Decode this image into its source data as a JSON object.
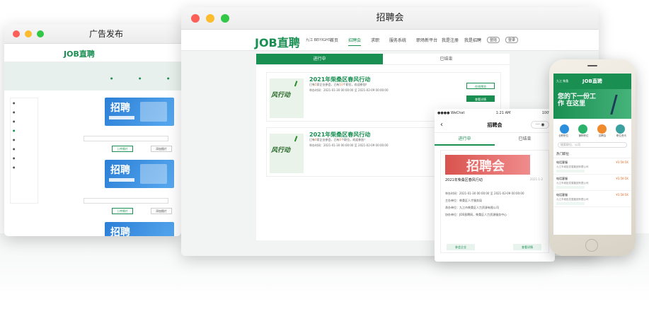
{
  "window_ad": {
    "title": "广告发布",
    "logo": "JOB直聘",
    "ad_banner_text": "招聘",
    "upload_button": "上传图片",
    "add_button": "添加图片"
  },
  "window_fair": {
    "title": "招聘会",
    "logo": "JOB直聘",
    "city": "九江 BEIYIGHS",
    "nav": [
      "首页",
      "招聘会",
      "求职",
      "服务系统",
      "职场新平台",
      "我是注册",
      "我是招聘"
    ],
    "nav_login": "登陆",
    "nav_register": "登录",
    "tabs": [
      "进行中",
      "已结束"
    ],
    "jobs": [
      {
        "title": "2021年柴桑区春风行动",
        "sub_prefix": "已有",
        "sub_count1": "5",
        "sub_mid": "家企业参会，已有",
        "sub_count2": "10",
        "sub_suffix": "个职位，欢迎参加！",
        "time": "举办时间：2021-01-30 00:00:00 至 2021-02-09 00:00:00",
        "btn1": "在线预览",
        "btn2": "查看详情",
        "badge": "风行动"
      },
      {
        "title": "2021年柴桑区春风行动",
        "sub_prefix": "已有",
        "sub_count1": "0",
        "sub_mid": "家企业参会，已有",
        "sub_count2": "0",
        "sub_suffix": "个职位，欢迎参加！",
        "time": "举办时间：2021-01-30 00:00:00 至 2021-02-09 00:00:00",
        "badge": "风行动"
      }
    ]
  },
  "window_mobile": {
    "status_left": "●●●● WeChat",
    "status_time": "1:21 AM",
    "status_right": "100%",
    "title": "招聘会",
    "tabs": [
      "进行中",
      "已结束"
    ],
    "banner": "招聘会",
    "card_title": "2021年柴桑区春风行动",
    "card_date": "2021-1-2",
    "lines": [
      "举办时间：2021-01-30 00:00:00 至 2021-02-09 00:00:00",
      "主办单位：柴桑区人才服务局",
      "承办单位：九江市柴桑区人力资源有限公司",
      "协办单位：JOB直聘网，柴桑区人力资源服务中心"
    ],
    "btn_join": "参会企业",
    "btn_detail": "查看详情"
  },
  "phone": {
    "city": "九江 柴桑",
    "logo": "JOB直聘",
    "banner": "您的下一份工作 在这里",
    "icons": [
      "全职职位",
      "兼职职位",
      "招聘会",
      "职位资讯"
    ],
    "search": "搜索职位、公司",
    "section": "热门职位",
    "jobs": [
      {
        "name": "电话客服",
        "salary": "¥3.5K-5K",
        "company": "九江市城投发展集团有限公司"
      },
      {
        "name": "电话客服",
        "salary": "¥3.5K-5K",
        "company": "九江市城投发展集团有限公司"
      },
      {
        "name": "电话客服",
        "salary": "¥3.5K-5K",
        "company": "九江市城投发展集团有限公司"
      }
    ]
  },
  "colors": {
    "brand": "#1a8f52",
    "accent": "#e8712c"
  }
}
